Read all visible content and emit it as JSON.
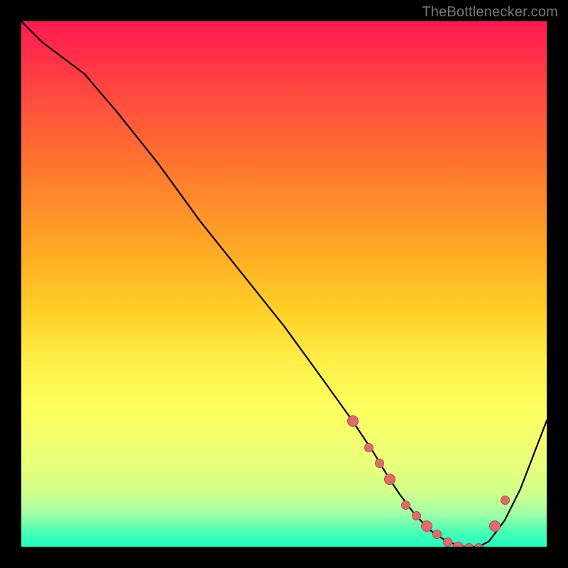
{
  "watermark": "TheBottlenecker.com",
  "chart_data": {
    "type": "line",
    "title": "",
    "xlabel": "",
    "ylabel": "",
    "xlim": [
      0,
      100
    ],
    "ylim": [
      0,
      100
    ],
    "x": [
      0,
      4,
      8,
      12,
      18,
      26,
      34,
      42,
      50,
      58,
      63,
      67,
      70,
      72,
      75,
      78,
      81,
      84,
      87,
      89,
      92,
      95,
      100
    ],
    "values": [
      100,
      96,
      93,
      90,
      83,
      73,
      62,
      52,
      42,
      31,
      24,
      18,
      13,
      10,
      6,
      3,
      1,
      0,
      0,
      1,
      5,
      11,
      24
    ],
    "markers_x": [
      63,
      66,
      68,
      70,
      73,
      75,
      77,
      79,
      81,
      83,
      85,
      87,
      90,
      92
    ],
    "markers_y": [
      24,
      19,
      16,
      13,
      8,
      6,
      4,
      2.5,
      1,
      0,
      0,
      0,
      4,
      9
    ],
    "notes": "Values are relative percentages (0-100). Background is a vertical red-to-green gradient with no visible axis labels."
  }
}
